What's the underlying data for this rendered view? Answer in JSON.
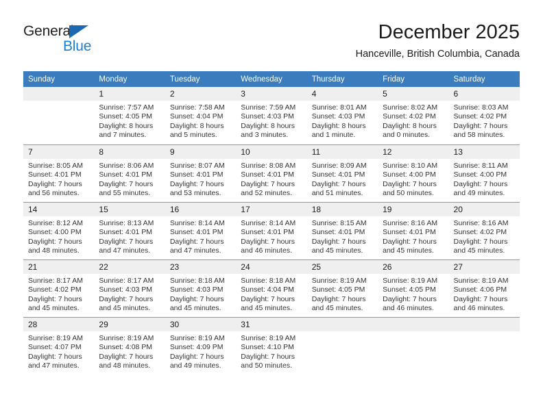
{
  "brand": {
    "line1": "General",
    "line2": "Blue"
  },
  "header": {
    "title": "December 2025",
    "subtitle": "Hanceville, British Columbia, Canada"
  },
  "colors": {
    "header_bar": "#3a7cbe",
    "brand_blue": "#1b7fd4",
    "daynum_bg": "#efefef"
  },
  "weekdays": [
    "Sunday",
    "Monday",
    "Tuesday",
    "Wednesday",
    "Thursday",
    "Friday",
    "Saturday"
  ],
  "labels": {
    "sunrise": "Sunrise:",
    "sunset": "Sunset:",
    "daylight": "Daylight:"
  },
  "weeks": [
    [
      {
        "day": "",
        "l1": "",
        "l2": "",
        "l3": "",
        "l4": ""
      },
      {
        "day": "1",
        "l1": "Sunrise: 7:57 AM",
        "l2": "Sunset: 4:05 PM",
        "l3": "Daylight: 8 hours",
        "l4": "and 7 minutes."
      },
      {
        "day": "2",
        "l1": "Sunrise: 7:58 AM",
        "l2": "Sunset: 4:04 PM",
        "l3": "Daylight: 8 hours",
        "l4": "and 5 minutes."
      },
      {
        "day": "3",
        "l1": "Sunrise: 7:59 AM",
        "l2": "Sunset: 4:03 PM",
        "l3": "Daylight: 8 hours",
        "l4": "and 3 minutes."
      },
      {
        "day": "4",
        "l1": "Sunrise: 8:01 AM",
        "l2": "Sunset: 4:03 PM",
        "l3": "Daylight: 8 hours",
        "l4": "and 1 minute."
      },
      {
        "day": "5",
        "l1": "Sunrise: 8:02 AM",
        "l2": "Sunset: 4:02 PM",
        "l3": "Daylight: 8 hours",
        "l4": "and 0 minutes."
      },
      {
        "day": "6",
        "l1": "Sunrise: 8:03 AM",
        "l2": "Sunset: 4:02 PM",
        "l3": "Daylight: 7 hours",
        "l4": "and 58 minutes."
      }
    ],
    [
      {
        "day": "7",
        "l1": "Sunrise: 8:05 AM",
        "l2": "Sunset: 4:01 PM",
        "l3": "Daylight: 7 hours",
        "l4": "and 56 minutes."
      },
      {
        "day": "8",
        "l1": "Sunrise: 8:06 AM",
        "l2": "Sunset: 4:01 PM",
        "l3": "Daylight: 7 hours",
        "l4": "and 55 minutes."
      },
      {
        "day": "9",
        "l1": "Sunrise: 8:07 AM",
        "l2": "Sunset: 4:01 PM",
        "l3": "Daylight: 7 hours",
        "l4": "and 53 minutes."
      },
      {
        "day": "10",
        "l1": "Sunrise: 8:08 AM",
        "l2": "Sunset: 4:01 PM",
        "l3": "Daylight: 7 hours",
        "l4": "and 52 minutes."
      },
      {
        "day": "11",
        "l1": "Sunrise: 8:09 AM",
        "l2": "Sunset: 4:01 PM",
        "l3": "Daylight: 7 hours",
        "l4": "and 51 minutes."
      },
      {
        "day": "12",
        "l1": "Sunrise: 8:10 AM",
        "l2": "Sunset: 4:00 PM",
        "l3": "Daylight: 7 hours",
        "l4": "and 50 minutes."
      },
      {
        "day": "13",
        "l1": "Sunrise: 8:11 AM",
        "l2": "Sunset: 4:00 PM",
        "l3": "Daylight: 7 hours",
        "l4": "and 49 minutes."
      }
    ],
    [
      {
        "day": "14",
        "l1": "Sunrise: 8:12 AM",
        "l2": "Sunset: 4:00 PM",
        "l3": "Daylight: 7 hours",
        "l4": "and 48 minutes."
      },
      {
        "day": "15",
        "l1": "Sunrise: 8:13 AM",
        "l2": "Sunset: 4:01 PM",
        "l3": "Daylight: 7 hours",
        "l4": "and 47 minutes."
      },
      {
        "day": "16",
        "l1": "Sunrise: 8:14 AM",
        "l2": "Sunset: 4:01 PM",
        "l3": "Daylight: 7 hours",
        "l4": "and 47 minutes."
      },
      {
        "day": "17",
        "l1": "Sunrise: 8:14 AM",
        "l2": "Sunset: 4:01 PM",
        "l3": "Daylight: 7 hours",
        "l4": "and 46 minutes."
      },
      {
        "day": "18",
        "l1": "Sunrise: 8:15 AM",
        "l2": "Sunset: 4:01 PM",
        "l3": "Daylight: 7 hours",
        "l4": "and 45 minutes."
      },
      {
        "day": "19",
        "l1": "Sunrise: 8:16 AM",
        "l2": "Sunset: 4:01 PM",
        "l3": "Daylight: 7 hours",
        "l4": "and 45 minutes."
      },
      {
        "day": "20",
        "l1": "Sunrise: 8:16 AM",
        "l2": "Sunset: 4:02 PM",
        "l3": "Daylight: 7 hours",
        "l4": "and 45 minutes."
      }
    ],
    [
      {
        "day": "21",
        "l1": "Sunrise: 8:17 AM",
        "l2": "Sunset: 4:02 PM",
        "l3": "Daylight: 7 hours",
        "l4": "and 45 minutes."
      },
      {
        "day": "22",
        "l1": "Sunrise: 8:17 AM",
        "l2": "Sunset: 4:03 PM",
        "l3": "Daylight: 7 hours",
        "l4": "and 45 minutes."
      },
      {
        "day": "23",
        "l1": "Sunrise: 8:18 AM",
        "l2": "Sunset: 4:03 PM",
        "l3": "Daylight: 7 hours",
        "l4": "and 45 minutes."
      },
      {
        "day": "24",
        "l1": "Sunrise: 8:18 AM",
        "l2": "Sunset: 4:04 PM",
        "l3": "Daylight: 7 hours",
        "l4": "and 45 minutes."
      },
      {
        "day": "25",
        "l1": "Sunrise: 8:19 AM",
        "l2": "Sunset: 4:05 PM",
        "l3": "Daylight: 7 hours",
        "l4": "and 45 minutes."
      },
      {
        "day": "26",
        "l1": "Sunrise: 8:19 AM",
        "l2": "Sunset: 4:05 PM",
        "l3": "Daylight: 7 hours",
        "l4": "and 46 minutes."
      },
      {
        "day": "27",
        "l1": "Sunrise: 8:19 AM",
        "l2": "Sunset: 4:06 PM",
        "l3": "Daylight: 7 hours",
        "l4": "and 46 minutes."
      }
    ],
    [
      {
        "day": "28",
        "l1": "Sunrise: 8:19 AM",
        "l2": "Sunset: 4:07 PM",
        "l3": "Daylight: 7 hours",
        "l4": "and 47 minutes."
      },
      {
        "day": "29",
        "l1": "Sunrise: 8:19 AM",
        "l2": "Sunset: 4:08 PM",
        "l3": "Daylight: 7 hours",
        "l4": "and 48 minutes."
      },
      {
        "day": "30",
        "l1": "Sunrise: 8:19 AM",
        "l2": "Sunset: 4:09 PM",
        "l3": "Daylight: 7 hours",
        "l4": "and 49 minutes."
      },
      {
        "day": "31",
        "l1": "Sunrise: 8:19 AM",
        "l2": "Sunset: 4:10 PM",
        "l3": "Daylight: 7 hours",
        "l4": "and 50 minutes."
      },
      {
        "day": "",
        "l1": "",
        "l2": "",
        "l3": "",
        "l4": ""
      },
      {
        "day": "",
        "l1": "",
        "l2": "",
        "l3": "",
        "l4": ""
      },
      {
        "day": "",
        "l1": "",
        "l2": "",
        "l3": "",
        "l4": ""
      }
    ]
  ]
}
